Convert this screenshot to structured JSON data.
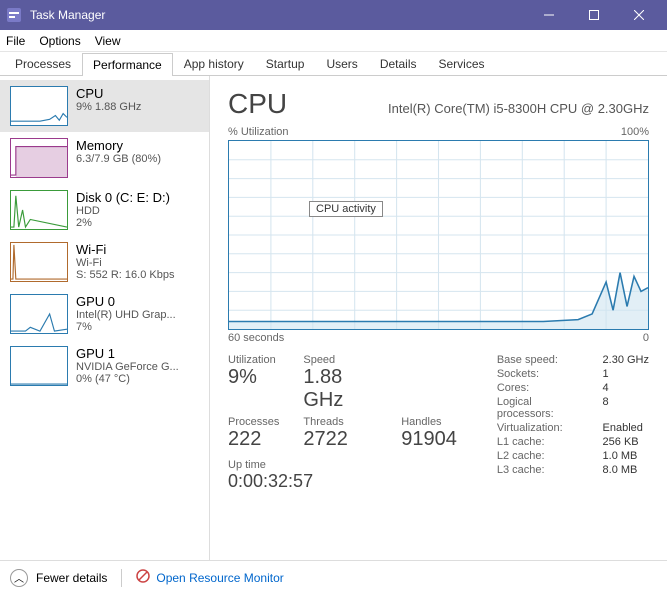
{
  "window": {
    "title": "Task Manager"
  },
  "menu": {
    "file": "File",
    "options": "Options",
    "view": "View"
  },
  "tabs": {
    "processes": "Processes",
    "performance": "Performance",
    "apphistory": "App history",
    "startup": "Startup",
    "users": "Users",
    "details": "Details",
    "services": "Services"
  },
  "sidebar": {
    "cpu": {
      "title": "CPU",
      "sub": "9% 1.88 GHz",
      "color": "#2b7baf"
    },
    "memory": {
      "title": "Memory",
      "sub": "6.3/7.9 GB (80%)",
      "color": "#9b3b8d"
    },
    "disk": {
      "title": "Disk 0 (C: E: D:)",
      "sub": "HDD",
      "sub2": "2%",
      "color": "#3a9b3a"
    },
    "wifi": {
      "title": "Wi-Fi",
      "sub": "Wi-Fi",
      "sub2": "S: 552 R: 16.0 Kbps",
      "color": "#b06a2d"
    },
    "gpu0": {
      "title": "GPU 0",
      "sub": "Intel(R) UHD Grap...",
      "sub2": "7%",
      "color": "#2b7baf"
    },
    "gpu1": {
      "title": "GPU 1",
      "sub": "NVIDIA GeForce G...",
      "sub2": "0% (47 °C)",
      "color": "#2b7baf"
    }
  },
  "detail": {
    "title": "CPU",
    "subtitle": "Intel(R) Core(TM) i5-8300H CPU @ 2.30GHz",
    "chart_top_left": "% Utilization",
    "chart_top_right": "100%",
    "chart_bottom_left": "60 seconds",
    "chart_bottom_right": "0",
    "tooltip": "CPU activity",
    "stats": {
      "utilization_lbl": "Utilization",
      "utilization_val": "9%",
      "speed_lbl": "Speed",
      "speed_val": "1.88 GHz",
      "processes_lbl": "Processes",
      "processes_val": "222",
      "threads_lbl": "Threads",
      "threads_val": "2722",
      "handles_lbl": "Handles",
      "handles_val": "91904",
      "uptime_lbl": "Up time",
      "uptime_val": "0:00:32:57"
    },
    "right": {
      "base_speed_k": "Base speed:",
      "base_speed_v": "2.30 GHz",
      "sockets_k": "Sockets:",
      "sockets_v": "1",
      "cores_k": "Cores:",
      "cores_v": "4",
      "logical_k": "Logical processors:",
      "logical_v": "8",
      "virt_k": "Virtualization:",
      "virt_v": "Enabled",
      "l1_k": "L1 cache:",
      "l1_v": "256 KB",
      "l2_k": "L2 cache:",
      "l2_v": "1.0 MB",
      "l3_k": "L3 cache:",
      "l3_v": "8.0 MB"
    }
  },
  "footer": {
    "fewer": "Fewer details",
    "resmon": "Open Resource Monitor"
  },
  "chart_data": {
    "type": "line",
    "title": "CPU % Utilization",
    "xlabel": "seconds ago",
    "ylabel": "% Utilization",
    "ylim": [
      0,
      100
    ],
    "xrange": [
      60,
      0
    ],
    "x": [
      60,
      55,
      50,
      45,
      40,
      35,
      30,
      25,
      20,
      15,
      10,
      8,
      6,
      5,
      4,
      3,
      2,
      1,
      0
    ],
    "values": [
      4,
      4,
      4,
      4,
      4,
      4,
      4,
      4,
      4,
      4,
      5,
      8,
      25,
      10,
      30,
      12,
      28,
      20,
      22
    ]
  }
}
